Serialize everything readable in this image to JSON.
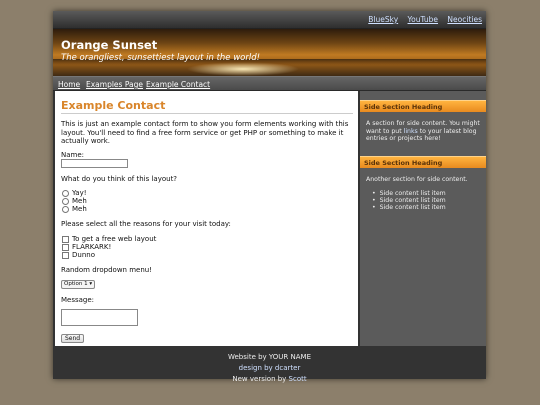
{
  "top_links": [
    "BlueSky",
    "YouTube",
    "Neocities"
  ],
  "banner": {
    "title": "Orange Sunset",
    "tagline": "The orangliest, sunsettiest layout in the world!"
  },
  "nav": [
    "Home",
    "Examples Page",
    "Example Contact"
  ],
  "main": {
    "heading": "Example Contact",
    "intro_1": "This is just an example contact form to show you form elements working with this",
    "intro_2": "layout. You'll need to find a free form service or get PHP or something to make it",
    "intro_3": "actually work.",
    "name_label": "Name:",
    "question": "What do you think of this layout?",
    "radios": [
      "Yay!",
      "Meh",
      "Meh"
    ],
    "reasons_label": "Please select all the reasons for your visit today:",
    "checkboxes": [
      "To get a free web layout",
      "FLARKARK!",
      "Dunno"
    ],
    "dropdown_label": "Random dropdown menu!",
    "dropdown_value": "Option 1",
    "message_label": "Message:",
    "send_label": "Send"
  },
  "sidebar": {
    "heading_1": "Side Section Heading",
    "text_1a": "A section for side content. You might",
    "text_1b_pre": "want to put ",
    "text_1b_link": "links",
    "text_1b_post": " to your latest blog",
    "text_1c": "entries or projects here!",
    "heading_2": "Side Section Heading",
    "text_2": "Another section for side content.",
    "list_items": [
      "Side content list item",
      "Side content list item",
      "Side content list item"
    ]
  },
  "footer": {
    "line_1": "Website by YOUR NAME",
    "line_2": "design by dcarter",
    "line_3_pre": "New version by ",
    "line_3_link": "Scott"
  },
  "colors": {
    "accent": "#d9852a",
    "side_heading": "#f5a030",
    "page_bg": "#8c7f6b"
  }
}
